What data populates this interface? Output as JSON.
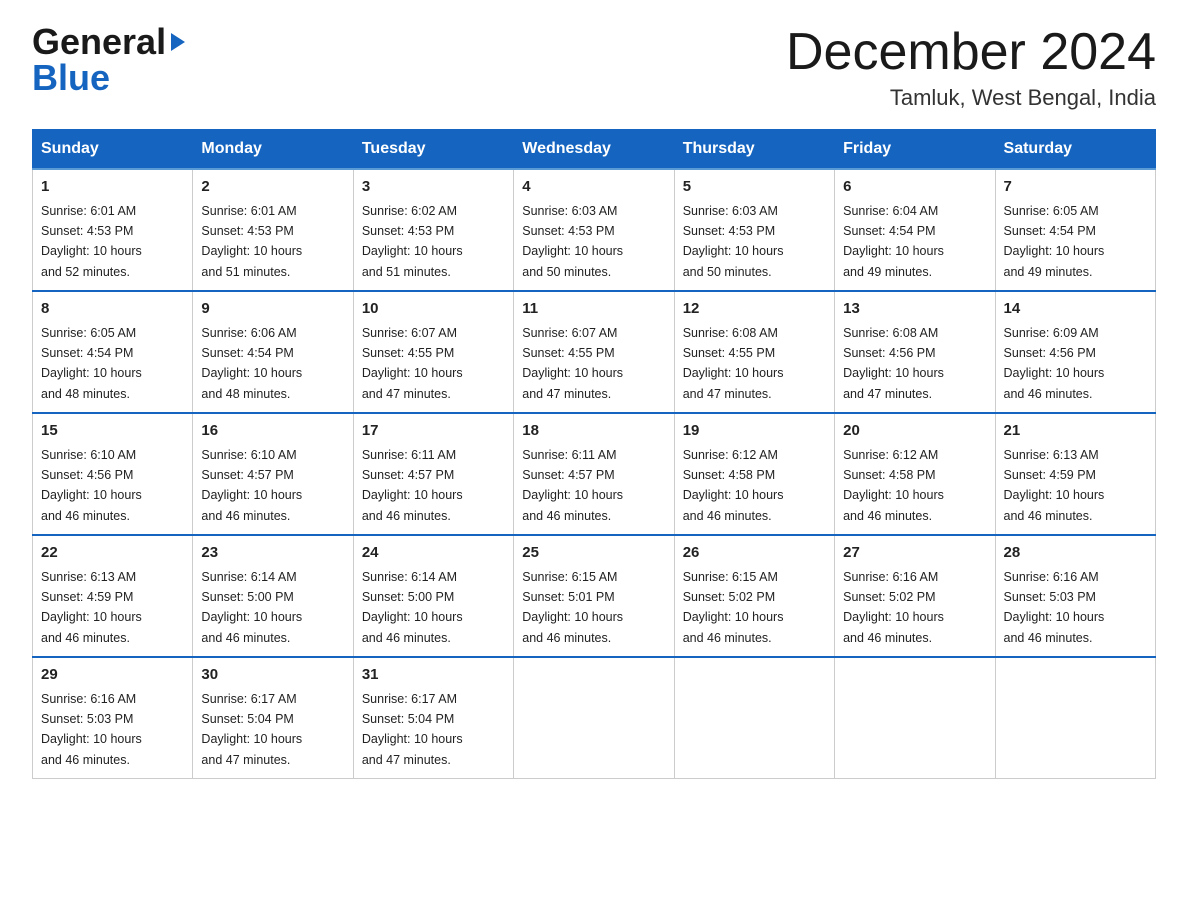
{
  "header": {
    "logo_line1": "General",
    "logo_line2": "Blue",
    "month_title": "December 2024",
    "location": "Tamluk, West Bengal, India"
  },
  "weekdays": [
    "Sunday",
    "Monday",
    "Tuesday",
    "Wednesday",
    "Thursday",
    "Friday",
    "Saturday"
  ],
  "weeks": [
    [
      {
        "day": "1",
        "sunrise": "6:01 AM",
        "sunset": "4:53 PM",
        "daylight": "10 hours and 52 minutes."
      },
      {
        "day": "2",
        "sunrise": "6:01 AM",
        "sunset": "4:53 PM",
        "daylight": "10 hours and 51 minutes."
      },
      {
        "day": "3",
        "sunrise": "6:02 AM",
        "sunset": "4:53 PM",
        "daylight": "10 hours and 51 minutes."
      },
      {
        "day": "4",
        "sunrise": "6:03 AM",
        "sunset": "4:53 PM",
        "daylight": "10 hours and 50 minutes."
      },
      {
        "day": "5",
        "sunrise": "6:03 AM",
        "sunset": "4:53 PM",
        "daylight": "10 hours and 50 minutes."
      },
      {
        "day": "6",
        "sunrise": "6:04 AM",
        "sunset": "4:54 PM",
        "daylight": "10 hours and 49 minutes."
      },
      {
        "day": "7",
        "sunrise": "6:05 AM",
        "sunset": "4:54 PM",
        "daylight": "10 hours and 49 minutes."
      }
    ],
    [
      {
        "day": "8",
        "sunrise": "6:05 AM",
        "sunset": "4:54 PM",
        "daylight": "10 hours and 48 minutes."
      },
      {
        "day": "9",
        "sunrise": "6:06 AM",
        "sunset": "4:54 PM",
        "daylight": "10 hours and 48 minutes."
      },
      {
        "day": "10",
        "sunrise": "6:07 AM",
        "sunset": "4:55 PM",
        "daylight": "10 hours and 47 minutes."
      },
      {
        "day": "11",
        "sunrise": "6:07 AM",
        "sunset": "4:55 PM",
        "daylight": "10 hours and 47 minutes."
      },
      {
        "day": "12",
        "sunrise": "6:08 AM",
        "sunset": "4:55 PM",
        "daylight": "10 hours and 47 minutes."
      },
      {
        "day": "13",
        "sunrise": "6:08 AM",
        "sunset": "4:56 PM",
        "daylight": "10 hours and 47 minutes."
      },
      {
        "day": "14",
        "sunrise": "6:09 AM",
        "sunset": "4:56 PM",
        "daylight": "10 hours and 46 minutes."
      }
    ],
    [
      {
        "day": "15",
        "sunrise": "6:10 AM",
        "sunset": "4:56 PM",
        "daylight": "10 hours and 46 minutes."
      },
      {
        "day": "16",
        "sunrise": "6:10 AM",
        "sunset": "4:57 PM",
        "daylight": "10 hours and 46 minutes."
      },
      {
        "day": "17",
        "sunrise": "6:11 AM",
        "sunset": "4:57 PM",
        "daylight": "10 hours and 46 minutes."
      },
      {
        "day": "18",
        "sunrise": "6:11 AM",
        "sunset": "4:57 PM",
        "daylight": "10 hours and 46 minutes."
      },
      {
        "day": "19",
        "sunrise": "6:12 AM",
        "sunset": "4:58 PM",
        "daylight": "10 hours and 46 minutes."
      },
      {
        "day": "20",
        "sunrise": "6:12 AM",
        "sunset": "4:58 PM",
        "daylight": "10 hours and 46 minutes."
      },
      {
        "day": "21",
        "sunrise": "6:13 AM",
        "sunset": "4:59 PM",
        "daylight": "10 hours and 46 minutes."
      }
    ],
    [
      {
        "day": "22",
        "sunrise": "6:13 AM",
        "sunset": "4:59 PM",
        "daylight": "10 hours and 46 minutes."
      },
      {
        "day": "23",
        "sunrise": "6:14 AM",
        "sunset": "5:00 PM",
        "daylight": "10 hours and 46 minutes."
      },
      {
        "day": "24",
        "sunrise": "6:14 AM",
        "sunset": "5:00 PM",
        "daylight": "10 hours and 46 minutes."
      },
      {
        "day": "25",
        "sunrise": "6:15 AM",
        "sunset": "5:01 PM",
        "daylight": "10 hours and 46 minutes."
      },
      {
        "day": "26",
        "sunrise": "6:15 AM",
        "sunset": "5:02 PM",
        "daylight": "10 hours and 46 minutes."
      },
      {
        "day": "27",
        "sunrise": "6:16 AM",
        "sunset": "5:02 PM",
        "daylight": "10 hours and 46 minutes."
      },
      {
        "day": "28",
        "sunrise": "6:16 AM",
        "sunset": "5:03 PM",
        "daylight": "10 hours and 46 minutes."
      }
    ],
    [
      {
        "day": "29",
        "sunrise": "6:16 AM",
        "sunset": "5:03 PM",
        "daylight": "10 hours and 46 minutes."
      },
      {
        "day": "30",
        "sunrise": "6:17 AM",
        "sunset": "5:04 PM",
        "daylight": "10 hours and 47 minutes."
      },
      {
        "day": "31",
        "sunrise": "6:17 AM",
        "sunset": "5:04 PM",
        "daylight": "10 hours and 47 minutes."
      },
      null,
      null,
      null,
      null
    ]
  ],
  "labels": {
    "sunrise": "Sunrise:",
    "sunset": "Sunset:",
    "daylight": "Daylight:"
  }
}
